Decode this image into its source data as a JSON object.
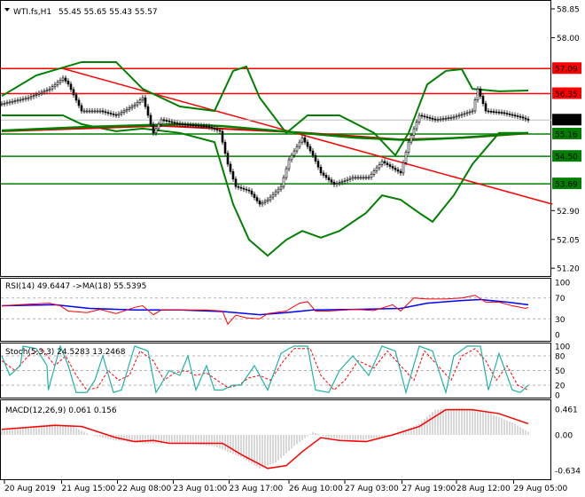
{
  "header": {
    "symbol": "WTI.fs,H1",
    "ohlc": "55.45 55.65 55.43 55.57"
  },
  "colors": {
    "up": "#000000",
    "bb": "#008000",
    "ma_red": "#e00000",
    "resistance": "#ff0000",
    "support": "#008000",
    "rsi": "#ff0000",
    "rsi_ma": "#0000ff",
    "stoch_main": "#20b2aa",
    "stoch_signal": "#ff0000",
    "macd_hist": "#b0b0b0",
    "macd_signal": "#ff0000"
  },
  "chart_data": [
    {
      "type": "line",
      "title": "WTI.fs,H1",
      "x_unit": "bar",
      "xlim": [
        0,
        207
      ],
      "ylim": [
        50.85,
        59.1
      ],
      "y_ticks": [
        "58.85",
        "58.00",
        "52.90",
        "52.05",
        "51.20"
      ],
      "current_price": "55.57",
      "levels": [
        {
          "value": 57.09,
          "label": "57.09",
          "kind": "resistance"
        },
        {
          "value": 56.35,
          "label": "56.35",
          "kind": "resistance"
        },
        {
          "value": 55.16,
          "label": "55.16",
          "kind": "support"
        },
        {
          "value": 54.5,
          "label": "54.50",
          "kind": "support"
        },
        {
          "value": 53.69,
          "label": "53.69",
          "kind": "support"
        }
      ],
      "trendline": [
        [
          23,
          57.09
        ],
        [
          207,
          53.09
        ]
      ],
      "close": [
        [
          0,
          56.05
        ],
        [
          10,
          56.23
        ],
        [
          18,
          56.49
        ],
        [
          23,
          56.81
        ],
        [
          25,
          56.63
        ],
        [
          30,
          55.84
        ],
        [
          37,
          55.84
        ],
        [
          43,
          55.71
        ],
        [
          50,
          56.02
        ],
        [
          53,
          56.23
        ],
        [
          57,
          55.19
        ],
        [
          60,
          55.58
        ],
        [
          67,
          55.45
        ],
        [
          77,
          55.39
        ],
        [
          82,
          55.24
        ],
        [
          85,
          54.27
        ],
        [
          88,
          53.61
        ],
        [
          93,
          53.48
        ],
        [
          97,
          53.09
        ],
        [
          100,
          53.22
        ],
        [
          105,
          53.61
        ],
        [
          108,
          54.4
        ],
        [
          113,
          55.05
        ],
        [
          117,
          54.53
        ],
        [
          120,
          54.01
        ],
        [
          125,
          53.67
        ],
        [
          132,
          53.88
        ],
        [
          138,
          53.88
        ],
        [
          143,
          54.35
        ],
        [
          150,
          54.01
        ],
        [
          153,
          54.92
        ],
        [
          157,
          55.71
        ],
        [
          163,
          55.58
        ],
        [
          170,
          55.66
        ],
        [
          177,
          55.84
        ],
        [
          179,
          56.49
        ],
        [
          182,
          55.84
        ],
        [
          188,
          55.79
        ],
        [
          195,
          55.66
        ],
        [
          198,
          55.57
        ]
      ],
      "bb_upper": [
        [
          0,
          56.28
        ],
        [
          13,
          56.89
        ],
        [
          30,
          57.28
        ],
        [
          43,
          57.28
        ],
        [
          53,
          56.49
        ],
        [
          67,
          55.97
        ],
        [
          80,
          55.84
        ],
        [
          87,
          57.02
        ],
        [
          92,
          57.15
        ],
        [
          97,
          56.23
        ],
        [
          107,
          55.19
        ],
        [
          115,
          55.71
        ],
        [
          127,
          55.71
        ],
        [
          140,
          55.19
        ],
        [
          148,
          54.53
        ],
        [
          153,
          55.19
        ],
        [
          160,
          56.62
        ],
        [
          167,
          57.02
        ],
        [
          173,
          57.07
        ],
        [
          177,
          56.49
        ],
        [
          187,
          56.42
        ],
        [
          198,
          56.44
        ]
      ],
      "bb_lower": [
        [
          0,
          55.71
        ],
        [
          23,
          55.71
        ],
        [
          30,
          55.45
        ],
        [
          43,
          55.24
        ],
        [
          53,
          55.32
        ],
        [
          67,
          55.19
        ],
        [
          80,
          54.92
        ],
        [
          87,
          53.09
        ],
        [
          93,
          52.04
        ],
        [
          100,
          51.57
        ],
        [
          107,
          52.04
        ],
        [
          113,
          52.3
        ],
        [
          120,
          52.1
        ],
        [
          127,
          52.3
        ],
        [
          137,
          52.83
        ],
        [
          143,
          53.35
        ],
        [
          150,
          53.22
        ],
        [
          157,
          52.83
        ],
        [
          162,
          52.57
        ],
        [
          170,
          53.35
        ],
        [
          177,
          54.27
        ],
        [
          187,
          55.19
        ],
        [
          198,
          55.19
        ]
      ],
      "bb_middle": [
        [
          0,
          55.26
        ],
        [
          33,
          55.37
        ],
        [
          67,
          55.45
        ],
        [
          83,
          55.39
        ],
        [
          113,
          55.19
        ],
        [
          133,
          55.05
        ],
        [
          153,
          54.98
        ],
        [
          173,
          55.05
        ],
        [
          198,
          55.19
        ]
      ],
      "ma_long": [
        [
          0,
          55.24
        ],
        [
          60,
          55.4
        ],
        [
          113,
          55.2
        ],
        [
          150,
          55.0
        ],
        [
          175,
          55.05
        ],
        [
          198,
          55.18
        ]
      ]
    },
    {
      "type": "line",
      "title": "RSI(14) 49.6447  ->MA(18) 55.5395",
      "ylim": [
        0,
        100
      ],
      "y_ticks": [
        "100",
        "70",
        "30",
        "0"
      ],
      "levels": [
        70,
        30
      ],
      "rsi": [
        [
          0,
          55
        ],
        [
          10,
          58
        ],
        [
          18,
          60
        ],
        [
          22,
          55
        ],
        [
          25,
          45
        ],
        [
          32,
          42
        ],
        [
          37,
          48
        ],
        [
          43,
          40
        ],
        [
          50,
          52
        ],
        [
          53,
          55
        ],
        [
          57,
          38
        ],
        [
          60,
          47
        ],
        [
          67,
          47
        ],
        [
          77,
          47
        ],
        [
          83,
          45
        ],
        [
          85,
          20
        ],
        [
          88,
          37
        ],
        [
          92,
          32
        ],
        [
          97,
          30
        ],
        [
          100,
          40
        ],
        [
          107,
          45
        ],
        [
          112,
          60
        ],
        [
          115,
          63
        ],
        [
          118,
          45
        ],
        [
          123,
          45
        ],
        [
          133,
          48
        ],
        [
          140,
          46
        ],
        [
          147,
          57
        ],
        [
          150,
          45
        ],
        [
          155,
          70
        ],
        [
          160,
          68
        ],
        [
          167,
          68
        ],
        [
          173,
          70
        ],
        [
          178,
          75
        ],
        [
          182,
          62
        ],
        [
          187,
          62
        ],
        [
          192,
          55
        ],
        [
          197,
          50
        ],
        [
          198,
          52
        ]
      ],
      "ma": [
        [
          0,
          55
        ],
        [
          20,
          57
        ],
        [
          33,
          50
        ],
        [
          50,
          47
        ],
        [
          67,
          47
        ],
        [
          83,
          44
        ],
        [
          97,
          38
        ],
        [
          107,
          42
        ],
        [
          117,
          47
        ],
        [
          133,
          48
        ],
        [
          150,
          50
        ],
        [
          160,
          60
        ],
        [
          173,
          65
        ],
        [
          180,
          67
        ],
        [
          190,
          62
        ],
        [
          198,
          57
        ]
      ]
    },
    {
      "type": "line",
      "title": "Stoch(5,3,3) 24.5283 13.2468",
      "ylim": [
        0,
        100
      ],
      "y_ticks": [
        "100",
        "80",
        "50",
        "20",
        "0"
      ],
      "levels": [
        80,
        50,
        20
      ],
      "main": [
        [
          0,
          80
        ],
        [
          3,
          40
        ],
        [
          7,
          60
        ],
        [
          8,
          100
        ],
        [
          13,
          95
        ],
        [
          17,
          60
        ],
        [
          17.5,
          10
        ],
        [
          22,
          100
        ],
        [
          25,
          60
        ],
        [
          28,
          5
        ],
        [
          32,
          5
        ],
        [
          35,
          30
        ],
        [
          38,
          80
        ],
        [
          42,
          5
        ],
        [
          45,
          10
        ],
        [
          50,
          100
        ],
        [
          55,
          90
        ],
        [
          58,
          5
        ],
        [
          63,
          50
        ],
        [
          67,
          40
        ],
        [
          70,
          80
        ],
        [
          73,
          10
        ],
        [
          77,
          60
        ],
        [
          80,
          10
        ],
        [
          83,
          10
        ],
        [
          87,
          20
        ],
        [
          90,
          20
        ],
        [
          95,
          60
        ],
        [
          100,
          10
        ],
        [
          105,
          85
        ],
        [
          108,
          95
        ],
        [
          110,
          100
        ],
        [
          115,
          100
        ],
        [
          118,
          10
        ],
        [
          123,
          5
        ],
        [
          127,
          50
        ],
        [
          132,
          80
        ],
        [
          138,
          40
        ],
        [
          143,
          100
        ],
        [
          148,
          90
        ],
        [
          152,
          5
        ],
        [
          157,
          100
        ],
        [
          162,
          90
        ],
        [
          167,
          5
        ],
        [
          170,
          80
        ],
        [
          175,
          100
        ],
        [
          180,
          100
        ],
        [
          183,
          10
        ],
        [
          187,
          85
        ],
        [
          192,
          10
        ],
        [
          195,
          5
        ],
        [
          198,
          20
        ]
      ],
      "signal": [
        [
          0,
          70
        ],
        [
          5,
          50
        ],
        [
          10,
          80
        ],
        [
          15,
          95
        ],
        [
          20,
          60
        ],
        [
          24,
          80
        ],
        [
          28,
          40
        ],
        [
          32,
          10
        ],
        [
          36,
          15
        ],
        [
          40,
          50
        ],
        [
          44,
          30
        ],
        [
          48,
          40
        ],
        [
          52,
          90
        ],
        [
          57,
          70
        ],
        [
          61,
          30
        ],
        [
          65,
          45
        ],
        [
          69,
          50
        ],
        [
          73,
          40
        ],
        [
          77,
          45
        ],
        [
          81,
          30
        ],
        [
          85,
          15
        ],
        [
          89,
          20
        ],
        [
          93,
          35
        ],
        [
          97,
          40
        ],
        [
          101,
          30
        ],
        [
          106,
          70
        ],
        [
          110,
          95
        ],
        [
          116,
          95
        ],
        [
          120,
          40
        ],
        [
          125,
          10
        ],
        [
          129,
          30
        ],
        [
          134,
          70
        ],
        [
          140,
          55
        ],
        [
          145,
          90
        ],
        [
          150,
          60
        ],
        [
          155,
          30
        ],
        [
          159,
          90
        ],
        [
          164,
          60
        ],
        [
          169,
          30
        ],
        [
          173,
          80
        ],
        [
          178,
          95
        ],
        [
          182,
          70
        ],
        [
          186,
          30
        ],
        [
          190,
          60
        ],
        [
          194,
          20
        ],
        [
          198,
          10
        ]
      ]
    },
    {
      "type": "bar",
      "title": "MACD(12,26,9) 0.061 0.156",
      "ylim": [
        -0.634,
        0.461
      ],
      "y_ticks": [
        "0.461",
        "0.00",
        "-0.634"
      ],
      "histogram": [
        [
          0,
          0.1
        ],
        [
          20,
          0.2
        ],
        [
          27,
          0.15
        ],
        [
          33,
          0.0
        ],
        [
          43,
          -0.1
        ],
        [
          53,
          -0.15
        ],
        [
          67,
          -0.15
        ],
        [
          80,
          -0.2
        ],
        [
          90,
          -0.4
        ],
        [
          97,
          -0.6
        ],
        [
          103,
          -0.5
        ],
        [
          110,
          -0.2
        ],
        [
          117,
          0.05
        ],
        [
          123,
          -0.05
        ],
        [
          133,
          -0.1
        ],
        [
          143,
          -0.05
        ],
        [
          150,
          0.05
        ],
        [
          157,
          0.2
        ],
        [
          163,
          0.45
        ],
        [
          173,
          0.48
        ],
        [
          183,
          0.4
        ],
        [
          193,
          0.2
        ],
        [
          198,
          0.05
        ]
      ],
      "signal": [
        [
          0,
          0.1
        ],
        [
          20,
          0.17
        ],
        [
          30,
          0.15
        ],
        [
          43,
          -0.05
        ],
        [
          50,
          -0.12
        ],
        [
          57,
          -0.1
        ],
        [
          63,
          -0.15
        ],
        [
          83,
          -0.15
        ],
        [
          90,
          -0.35
        ],
        [
          100,
          -0.6
        ],
        [
          107,
          -0.55
        ],
        [
          113,
          -0.3
        ],
        [
          120,
          -0.05
        ],
        [
          127,
          -0.1
        ],
        [
          137,
          -0.12
        ],
        [
          147,
          0.0
        ],
        [
          157,
          0.15
        ],
        [
          167,
          0.45
        ],
        [
          177,
          0.45
        ],
        [
          187,
          0.38
        ],
        [
          198,
          0.2
        ]
      ]
    }
  ],
  "time_axis": [
    {
      "bar": 1,
      "label": "20 Aug 2019"
    },
    {
      "bar": 22.5,
      "label": "21 Aug 15:00"
    },
    {
      "bar": 43.5,
      "label": "22 Aug 08:00"
    },
    {
      "bar": 64.5,
      "label": "23 Aug 01:00"
    },
    {
      "bar": 85.5,
      "label": "23 Aug 17:00"
    },
    {
      "bar": 108,
      "label": "26 Aug 10:00"
    },
    {
      "bar": 129,
      "label": "27 Aug 03:00"
    },
    {
      "bar": 150.5,
      "label": "27 Aug 19:00"
    },
    {
      "bar": 171,
      "label": "28 Aug 12:00"
    },
    {
      "bar": 192.5,
      "label": "29 Aug 05:00"
    }
  ]
}
